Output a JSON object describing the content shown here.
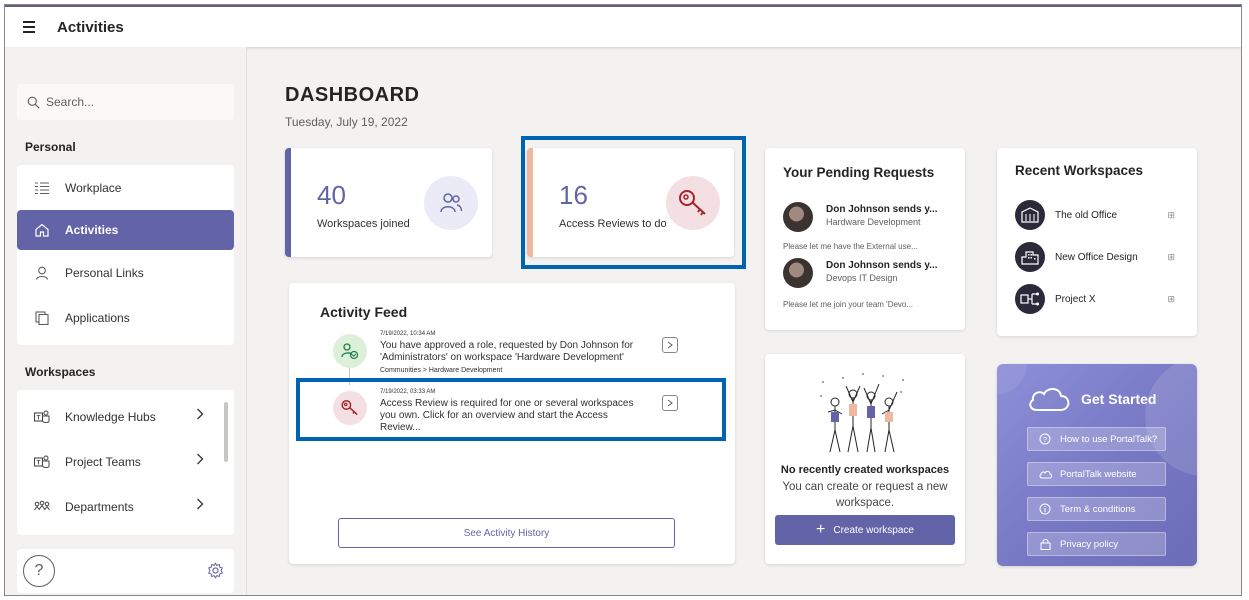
{
  "app": {
    "title": "Activities"
  },
  "sidebar": {
    "search_placeholder": "Search...",
    "personal_label": "Personal",
    "personal_items": [
      {
        "label": "Workplace",
        "icon": "list-icon"
      },
      {
        "label": "Activities",
        "icon": "home-icon",
        "active": true
      },
      {
        "label": "Personal Links",
        "icon": "person-icon"
      },
      {
        "label": "Applications",
        "icon": "apps-icon"
      }
    ],
    "workspaces_label": "Workspaces",
    "workspace_items": [
      {
        "label": "Knowledge Hubs",
        "icon": "teams-icon"
      },
      {
        "label": "Project Teams",
        "icon": "teams-icon"
      },
      {
        "label": "Departments",
        "icon": "org-icon"
      }
    ],
    "help_label": "?"
  },
  "dashboard": {
    "title": "DASHBOARD",
    "date": "Tuesday, July 19, 2022"
  },
  "stats": {
    "workspaces": {
      "value": "40",
      "label": "Workspaces joined",
      "accent": "#6264a7"
    },
    "reviews": {
      "value": "16",
      "label": "Access Reviews to do",
      "accent": "#f0b8a0"
    }
  },
  "activity_feed": {
    "title": "Activity Feed",
    "items": [
      {
        "time": "7/19/2022, 10:34 AM",
        "text": "You have approved a role, requested by Don Johnson for 'Administrators' on workspace 'Hardware Development'",
        "path": "Communities > Hardware Development"
      },
      {
        "time": "7/19/2022, 03:33 AM",
        "text": "Access Review is required for one or several workspaces you own. Click for an overview and start the Access Review...",
        "path": ""
      }
    ],
    "history_button": "See Activity History"
  },
  "pending_requests": {
    "title": "Your Pending Requests",
    "items": [
      {
        "name": "Don Johnson sends y...",
        "workspace": "Hardware Development",
        "message": "Please let me have the External use..."
      },
      {
        "name": "Don Johnson sends y...",
        "workspace": "Devops IT Design",
        "message": "Please let me join your team 'Devo..."
      }
    ]
  },
  "recent_workspaces": {
    "title": "Recent Workspaces",
    "items": [
      {
        "name": "The old Office"
      },
      {
        "name": "New Office Design"
      },
      {
        "name": "Project X"
      }
    ]
  },
  "empty_state": {
    "title": "No recently created workspaces",
    "text": "You can create or request a new workspace.",
    "button": "Create workspace"
  },
  "get_started": {
    "title": "Get Started",
    "links": [
      {
        "label": "How to use PortalTalk?",
        "icon": "help-circle-icon"
      },
      {
        "label": "PortalTalk website",
        "icon": "cloud-icon"
      },
      {
        "label": "Term & conditions",
        "icon": "info-icon"
      },
      {
        "label": "Privacy policy",
        "icon": "lock-icon"
      }
    ]
  }
}
